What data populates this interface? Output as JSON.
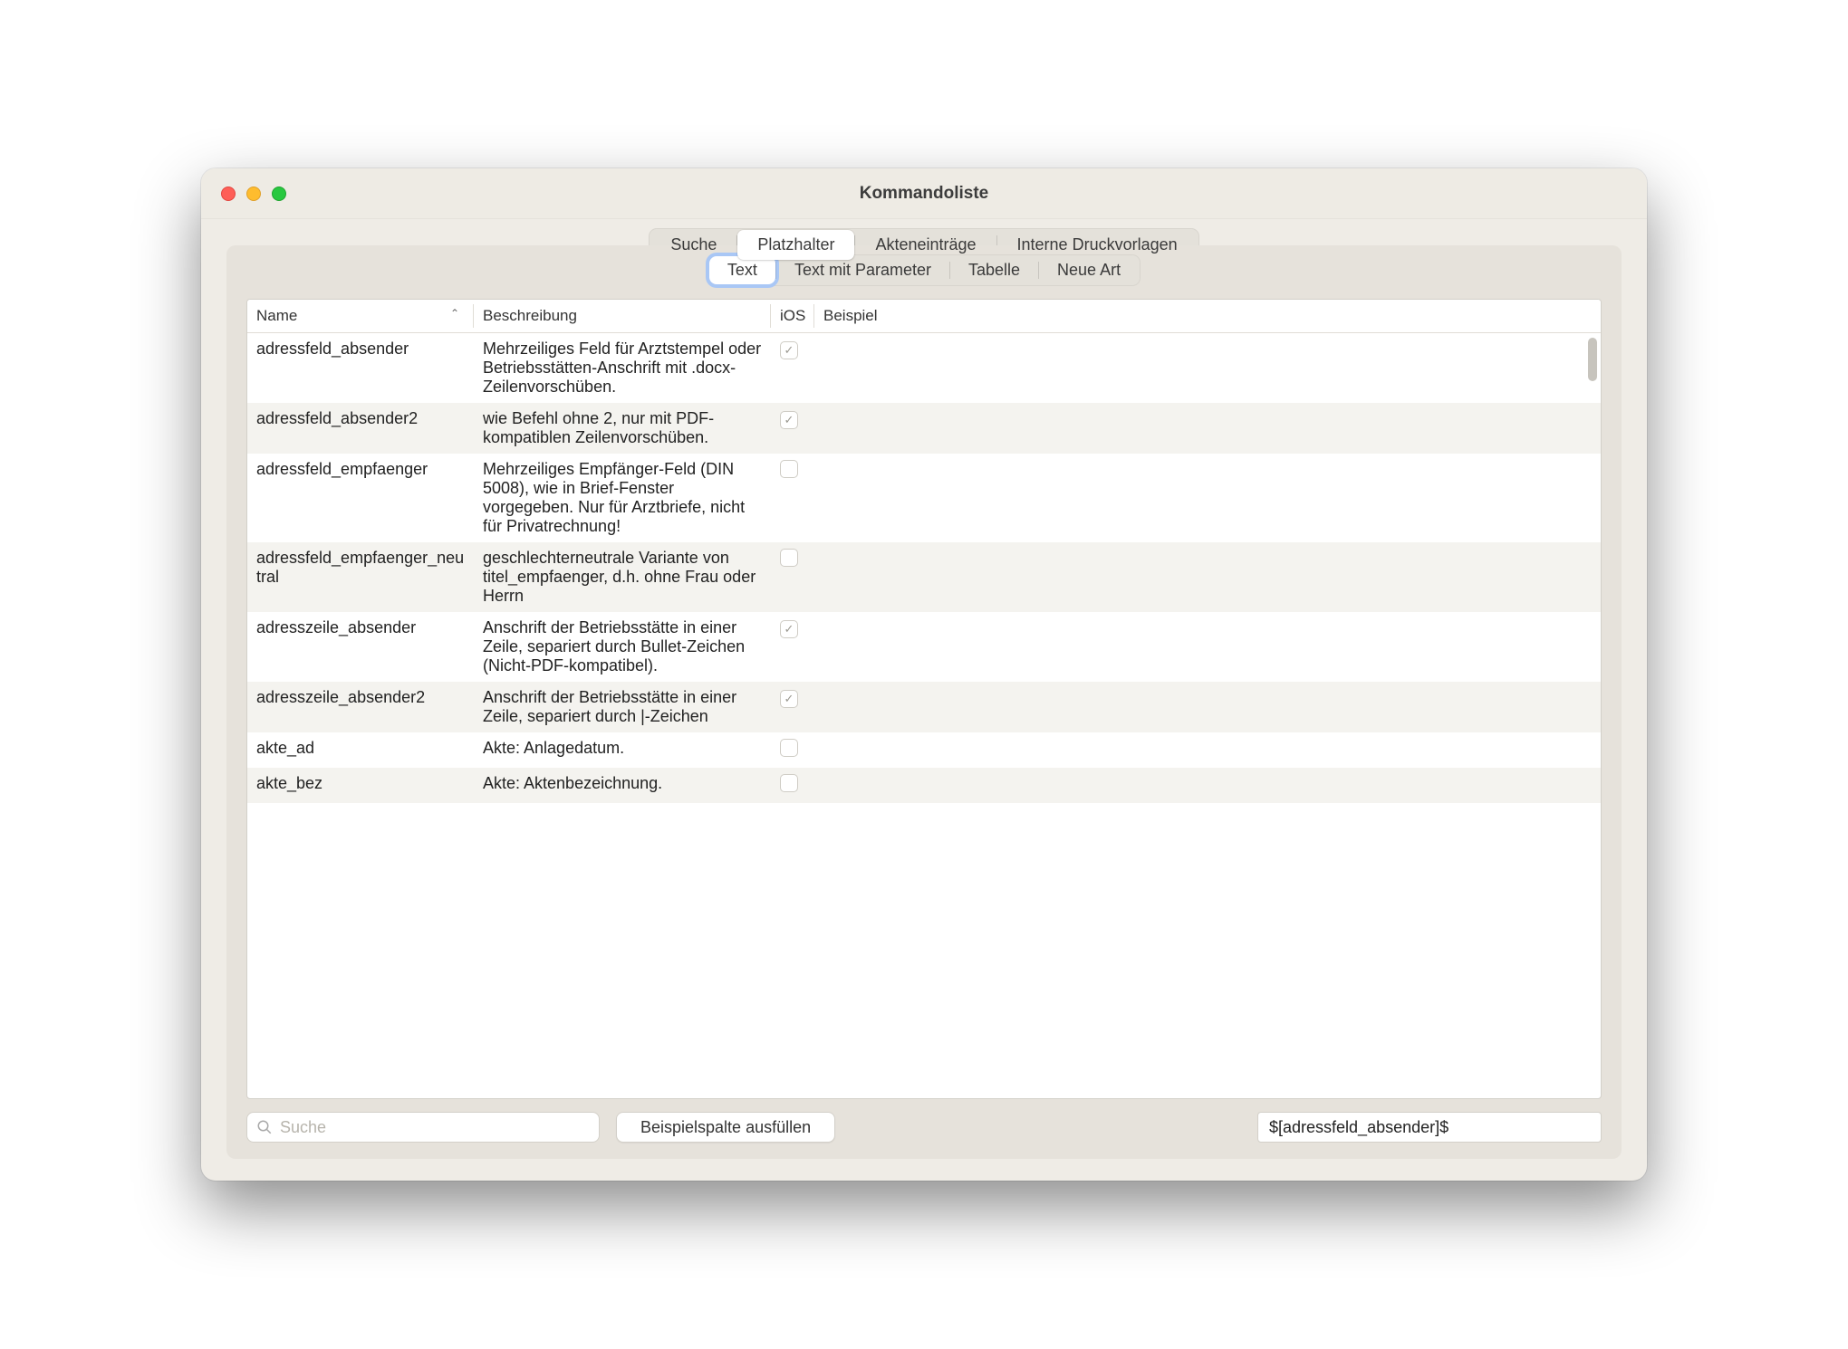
{
  "window": {
    "title": "Kommandoliste"
  },
  "tabs_top": {
    "items": [
      "Suche",
      "Platzhalter",
      "Akteneinträge",
      "Interne Druckvorlagen"
    ],
    "active_index": 1
  },
  "tabs_sub": {
    "items": [
      "Text",
      "Text mit Parameter",
      "Tabelle",
      "Neue Art"
    ],
    "active_index": 0
  },
  "table": {
    "headers": {
      "name": "Name",
      "desc": "Beschreibung",
      "ios": "iOS",
      "example": "Beispiel"
    },
    "sort_asc_on": "name",
    "rows": [
      {
        "name": "adressfeld_absender",
        "desc": "Mehrzeiliges Feld für Arztstempel oder Betriebsstätten-Anschrift mit .docx-Zeilenvorschüben.",
        "ios": true,
        "example": ""
      },
      {
        "name": "adressfeld_absender2",
        "desc": "wie Befehl ohne 2, nur mit PDF-kompatiblen Zeilenvorschüben.",
        "ios": true,
        "example": ""
      },
      {
        "name": "adressfeld_empfaenger",
        "desc": "Mehrzeiliges Empfänger-Feld (DIN 5008), wie in Brief-Fenster vorgegeben. Nur für Arztbriefe, nicht für Privatrechnung!",
        "ios": false,
        "example": ""
      },
      {
        "name": "adressfeld_empfaenger_neutral",
        "desc": "geschlechterneutrale Variante von  titel_empfaenger, d.h. ohne Frau oder Herrn",
        "ios": false,
        "example": ""
      },
      {
        "name": "adresszeile_absender",
        "desc": "Anschrift der Betriebsstätte in einer Zeile, separiert durch Bullet-Zeichen (Nicht-PDF-kompatibel).",
        "ios": true,
        "example": ""
      },
      {
        "name": "adresszeile_absender2",
        "desc": "Anschrift der Betriebsstätte in einer Zeile, separiert durch |-Zeichen",
        "ios": true,
        "example": ""
      },
      {
        "name": "akte_ad",
        "desc": "Akte: Anlagedatum.",
        "ios": false,
        "example": ""
      },
      {
        "name": "akte_bez",
        "desc": "Akte: Aktenbezeichnung.",
        "ios": false,
        "example": ""
      }
    ]
  },
  "footer": {
    "search_placeholder": "Suche",
    "fill_button": "Beispielspalte ausfüllen",
    "code_output": "$[adressfeld_absender]$"
  }
}
